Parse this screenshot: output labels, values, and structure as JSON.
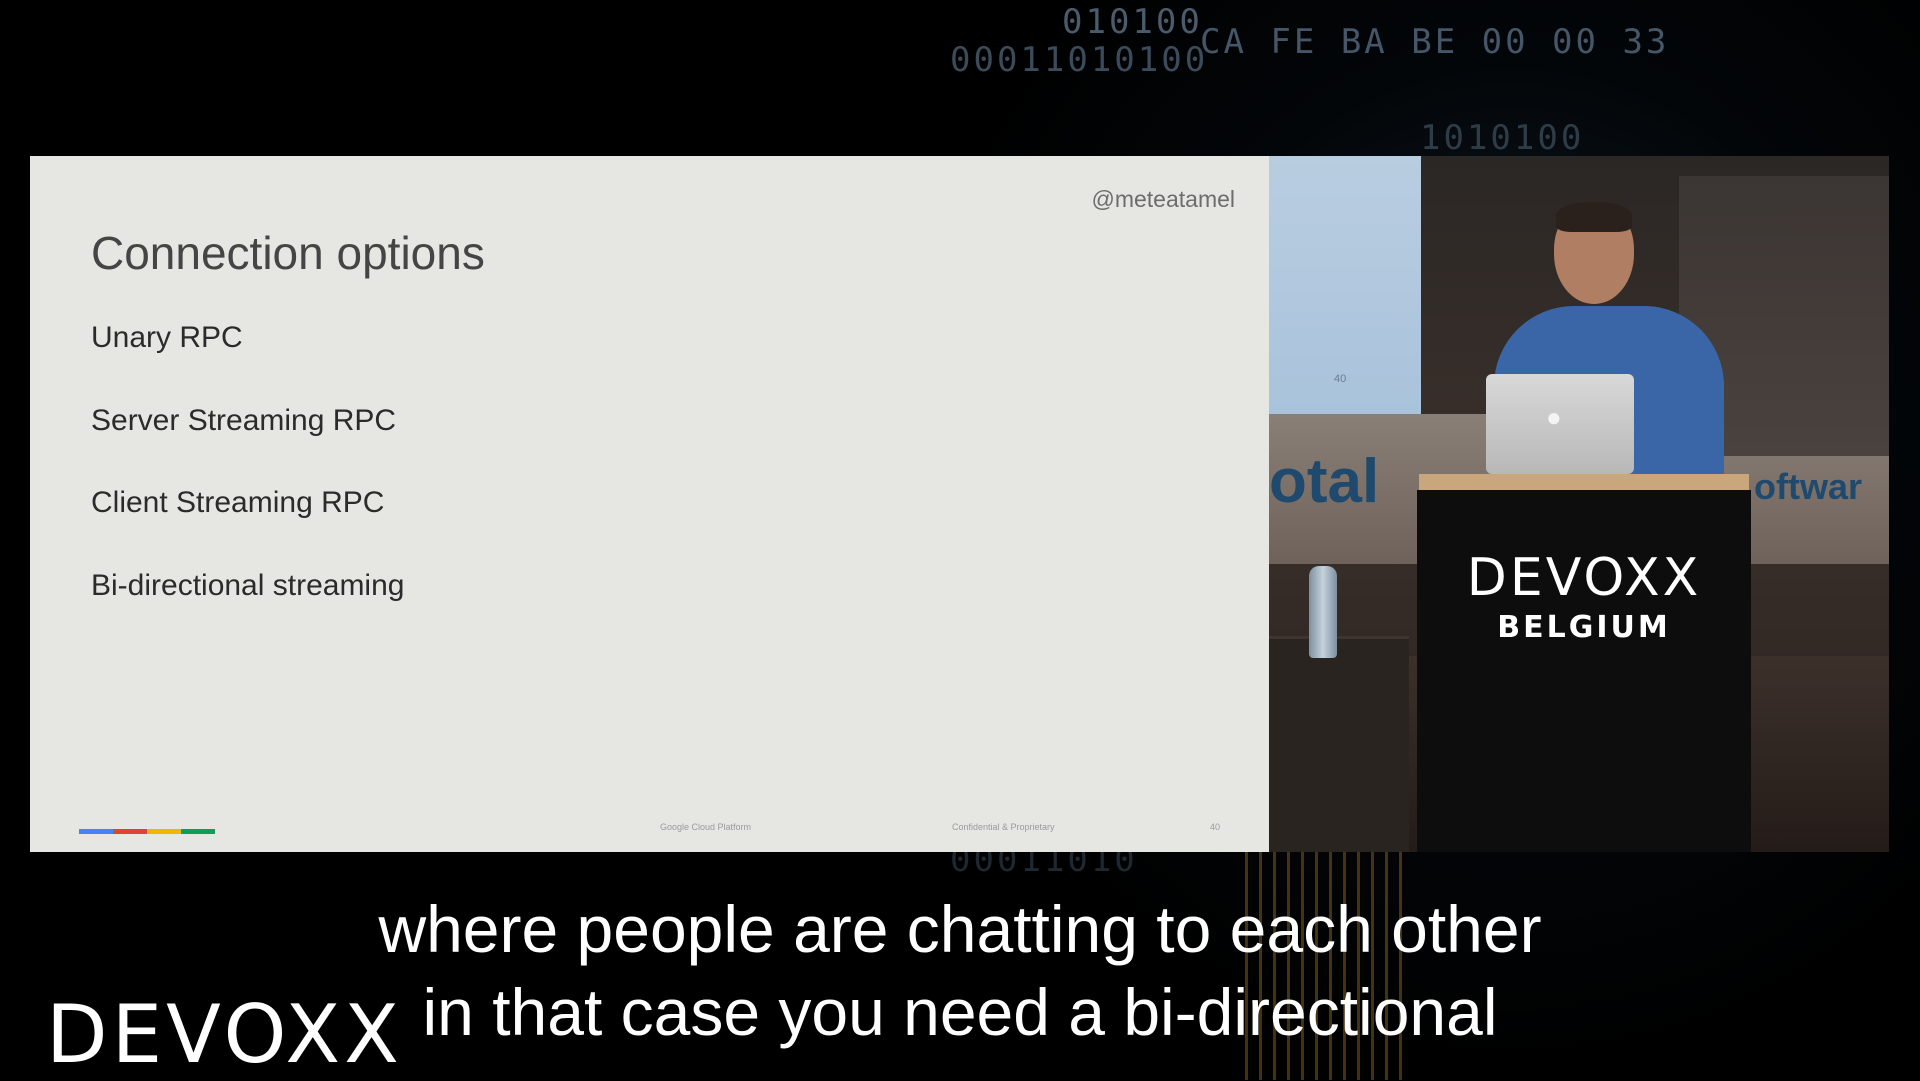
{
  "background_text": {
    "bin1": "010100",
    "bin2": "00011010100",
    "hex": "CA FE BA BE 00 00 33",
    "bin3": "1010100",
    "bin4": "00011010"
  },
  "slide": {
    "handle": "@meteatamel",
    "title": "Connection options",
    "bullets": [
      "Unary RPC",
      "Server Streaming RPC",
      "Client Streaming RPC",
      "Bi-directional streaming"
    ],
    "footer_platform": "Google Cloud Platform",
    "footer_confidential": "Confidential & Proprietary",
    "page_number": "40",
    "google_bar_colors": [
      "#4285f4",
      "#db4437",
      "#f4b400",
      "#0f9d58"
    ]
  },
  "camera": {
    "screen_number": "40",
    "banner_left": "otal",
    "banner_right": "oftwar",
    "podium_brand": "DEVOXX",
    "podium_location": "BELGIUM"
  },
  "subtitles": {
    "line1": "where people are chatting to each other",
    "line2": "in that case you need a bi-directional"
  },
  "logo": {
    "brand": "DEVOXX"
  }
}
